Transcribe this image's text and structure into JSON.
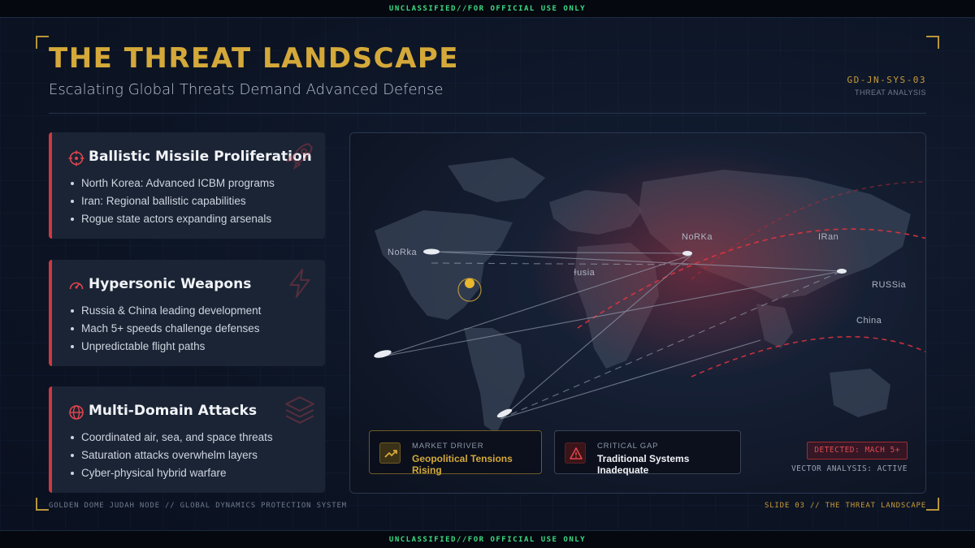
{
  "classification": "UNCLASSIFIED//FOR OFFICIAL USE ONLY",
  "header": {
    "title": "THE THREAT LANDSCAPE",
    "subtitle": "Escalating Global Threats Demand Advanced Defense",
    "code": "GD-JN-SYS-03",
    "code_label": "THREAT ANALYSIS"
  },
  "cards": [
    {
      "icon": "crosshair-icon",
      "title": "Ballistic Missile Proliferation",
      "bg_icon": "rocket-icon",
      "items": [
        "North Korea: Advanced ICBM programs",
        "Iran: Regional ballistic capabilities",
        "Rogue state actors expanding arsenals"
      ]
    },
    {
      "icon": "gauge-icon",
      "title": "Hypersonic Weapons",
      "bg_icon": "lightning-icon",
      "items": [
        "Russia & China leading development",
        "Mach 5+ speeds challenge defenses",
        "Unpredictable flight paths"
      ]
    },
    {
      "icon": "globe-icon",
      "title": "Multi-Domain Attacks",
      "bg_icon": "layers-icon",
      "items": [
        "Coordinated air, sea, and space threats",
        "Saturation attacks overwhelm layers",
        "Cyber-physical hybrid warfare"
      ]
    }
  ],
  "map": {
    "labels": [
      "NoRka",
      "ɫusia",
      "NoRKa",
      "IRan",
      "RUSSia",
      "China"
    ],
    "market_driver": {
      "label": "MARKET DRIVER",
      "value": "Geopolitical Tensions Rising",
      "icon": "trending-up-icon"
    },
    "critical_gap": {
      "label": "CRITICAL GAP",
      "value": "Traditional Systems Inadequate",
      "icon": "warning-icon"
    },
    "detected": "DETECTED: MACH 5+",
    "vector_status": "VECTOR ANALYSIS: ACTIVE"
  },
  "footer": {
    "left": "GOLDEN DOME JUDAH NODE // GLOBAL DYNAMICS PROTECTION SYSTEM",
    "right": "SLIDE 03 // THE THREAT LANDSCAPE"
  },
  "colors": {
    "gold": "#d4a93a",
    "alert_red": "#d2373f",
    "banner_green": "#3ddc84"
  }
}
